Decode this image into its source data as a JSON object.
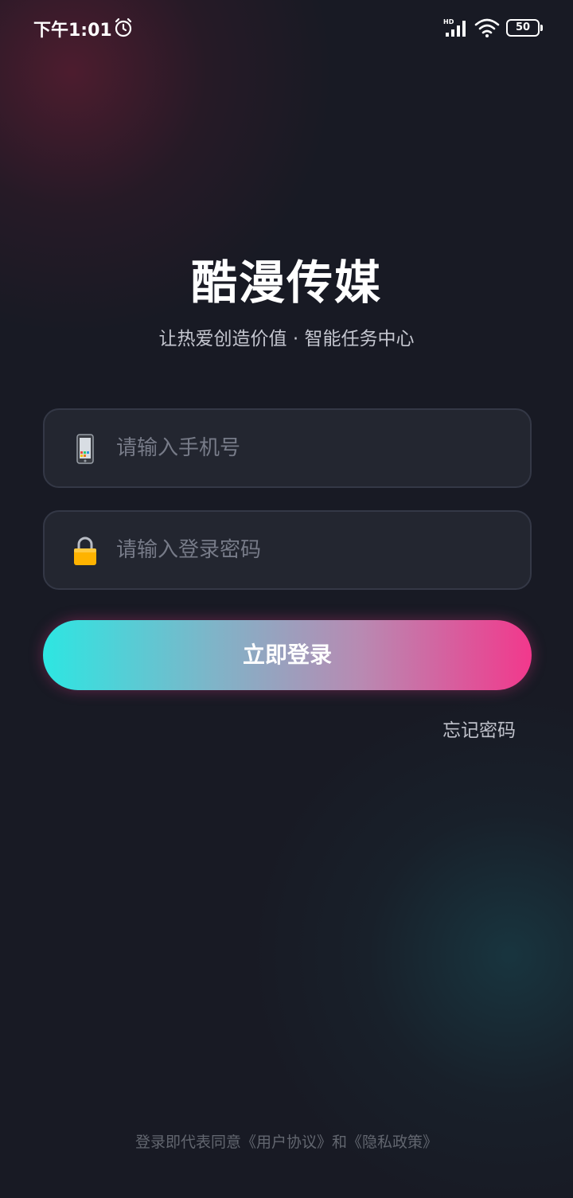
{
  "status_bar": {
    "time": "下午1:01",
    "network": "HD",
    "battery": "50"
  },
  "app": {
    "title": "酷漫传媒",
    "subtitle": "让热爱创造价值 · 智能任务中心"
  },
  "form": {
    "phone_placeholder": "请输入手机号",
    "password_placeholder": "请输入登录密码",
    "login_label": "立即登录",
    "forgot_label": "忘记密码"
  },
  "footer": {
    "agreement": "登录即代表同意《用户协议》和《隐私政策》"
  },
  "colors": {
    "background": "#181a24",
    "gradient_start": "#2de6e2",
    "gradient_end": "#f2388c",
    "field_bg": "#232630"
  },
  "icons": [
    "alarm-icon",
    "signal-icon",
    "wifi-icon",
    "battery-icon",
    "phone-icon",
    "lock-icon"
  ]
}
